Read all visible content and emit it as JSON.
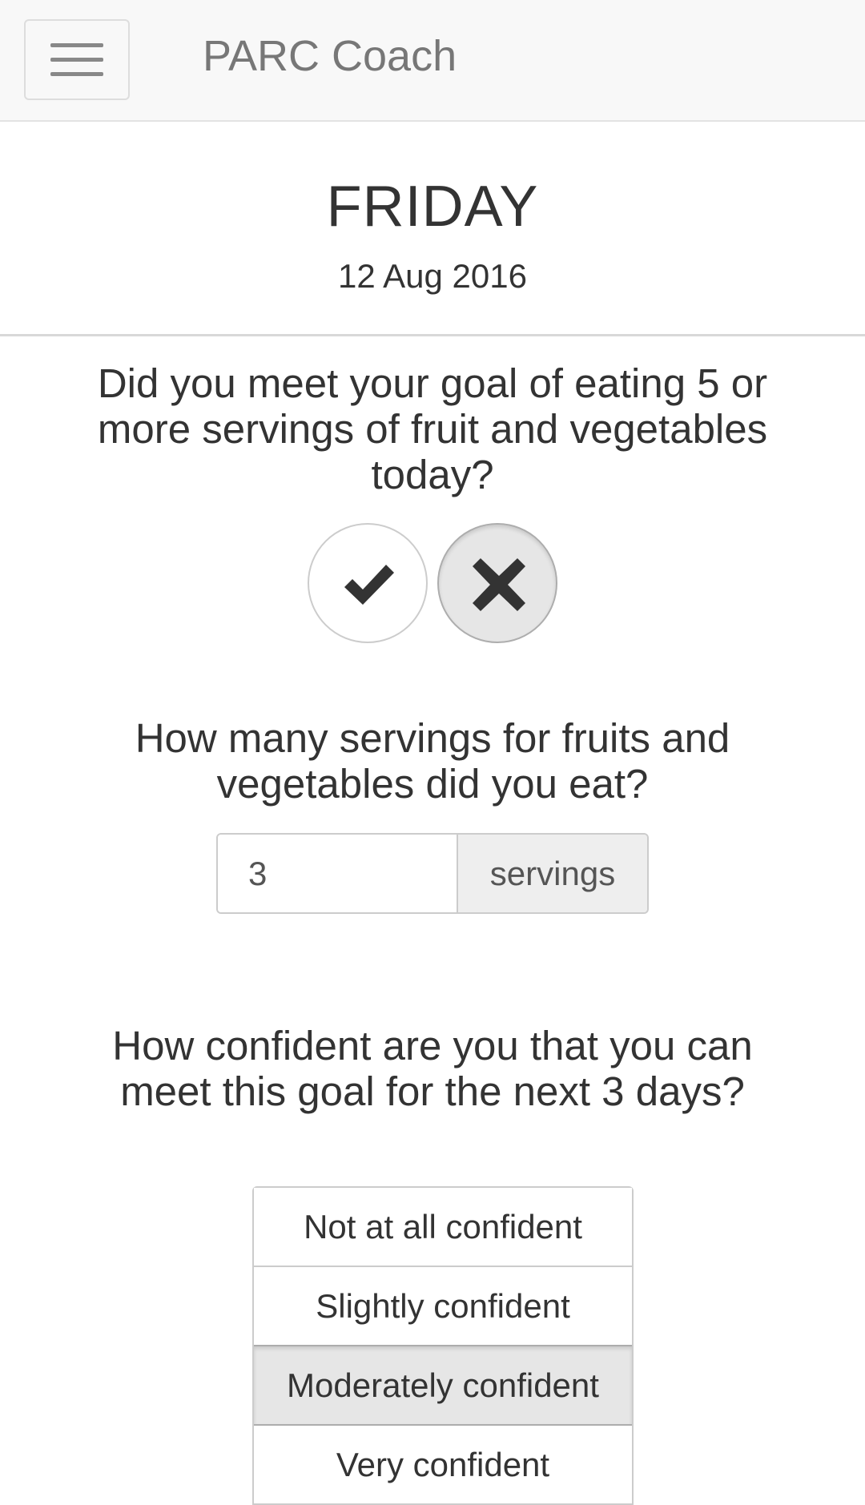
{
  "navbar": {
    "brand": "PARC Coach",
    "menu_icon": "hamburger-menu-icon"
  },
  "day": {
    "name": "FRIDAY",
    "date": "12 Aug 2016"
  },
  "goal_question": {
    "text": "Did you meet your goal of eating 5 or more servings of fruit and vegetables today?",
    "yes_icon": "checkmark-icon",
    "no_icon": "x-icon",
    "selected": "no"
  },
  "servings_question": {
    "text": "How many servings for fruits and vegetables did you eat?",
    "value": "3",
    "unit": "servings"
  },
  "confidence_question": {
    "text": "How confident are you that you can meet this goal for the next 3 days?",
    "options": [
      {
        "label": "Not at all confident"
      },
      {
        "label": "Slightly confident"
      },
      {
        "label": "Moderately confident"
      },
      {
        "label": "Very confident"
      }
    ],
    "selected": "Moderately confident"
  },
  "colors": {
    "navbar_bg": "#f8f8f8",
    "text": "#333333",
    "brand_text": "#777777",
    "selected_bg": "#e6e6e6",
    "border": "#cccccc"
  }
}
